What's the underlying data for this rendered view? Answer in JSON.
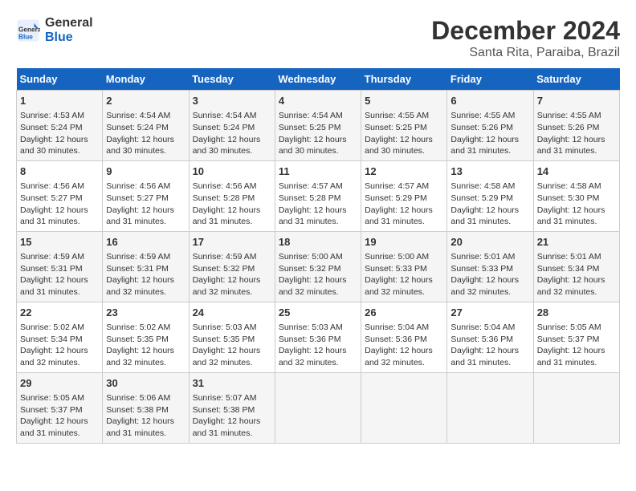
{
  "logo": {
    "line1": "General",
    "line2": "Blue"
  },
  "title": "December 2024",
  "subtitle": "Santa Rita, Paraiba, Brazil",
  "days_header": [
    "Sunday",
    "Monday",
    "Tuesday",
    "Wednesday",
    "Thursday",
    "Friday",
    "Saturday"
  ],
  "weeks": [
    [
      {
        "day": "1",
        "sunrise": "4:53 AM",
        "sunset": "5:24 PM",
        "daylight": "12 hours and 30 minutes."
      },
      {
        "day": "2",
        "sunrise": "4:54 AM",
        "sunset": "5:24 PM",
        "daylight": "12 hours and 30 minutes."
      },
      {
        "day": "3",
        "sunrise": "4:54 AM",
        "sunset": "5:24 PM",
        "daylight": "12 hours and 30 minutes."
      },
      {
        "day": "4",
        "sunrise": "4:54 AM",
        "sunset": "5:25 PM",
        "daylight": "12 hours and 30 minutes."
      },
      {
        "day": "5",
        "sunrise": "4:55 AM",
        "sunset": "5:25 PM",
        "daylight": "12 hours and 30 minutes."
      },
      {
        "day": "6",
        "sunrise": "4:55 AM",
        "sunset": "5:26 PM",
        "daylight": "12 hours and 31 minutes."
      },
      {
        "day": "7",
        "sunrise": "4:55 AM",
        "sunset": "5:26 PM",
        "daylight": "12 hours and 31 minutes."
      }
    ],
    [
      {
        "day": "8",
        "sunrise": "4:56 AM",
        "sunset": "5:27 PM",
        "daylight": "12 hours and 31 minutes."
      },
      {
        "day": "9",
        "sunrise": "4:56 AM",
        "sunset": "5:27 PM",
        "daylight": "12 hours and 31 minutes."
      },
      {
        "day": "10",
        "sunrise": "4:56 AM",
        "sunset": "5:28 PM",
        "daylight": "12 hours and 31 minutes."
      },
      {
        "day": "11",
        "sunrise": "4:57 AM",
        "sunset": "5:28 PM",
        "daylight": "12 hours and 31 minutes."
      },
      {
        "day": "12",
        "sunrise": "4:57 AM",
        "sunset": "5:29 PM",
        "daylight": "12 hours and 31 minutes."
      },
      {
        "day": "13",
        "sunrise": "4:58 AM",
        "sunset": "5:29 PM",
        "daylight": "12 hours and 31 minutes."
      },
      {
        "day": "14",
        "sunrise": "4:58 AM",
        "sunset": "5:30 PM",
        "daylight": "12 hours and 31 minutes."
      }
    ],
    [
      {
        "day": "15",
        "sunrise": "4:59 AM",
        "sunset": "5:31 PM",
        "daylight": "12 hours and 31 minutes."
      },
      {
        "day": "16",
        "sunrise": "4:59 AM",
        "sunset": "5:31 PM",
        "daylight": "12 hours and 32 minutes."
      },
      {
        "day": "17",
        "sunrise": "4:59 AM",
        "sunset": "5:32 PM",
        "daylight": "12 hours and 32 minutes."
      },
      {
        "day": "18",
        "sunrise": "5:00 AM",
        "sunset": "5:32 PM",
        "daylight": "12 hours and 32 minutes."
      },
      {
        "day": "19",
        "sunrise": "5:00 AM",
        "sunset": "5:33 PM",
        "daylight": "12 hours and 32 minutes."
      },
      {
        "day": "20",
        "sunrise": "5:01 AM",
        "sunset": "5:33 PM",
        "daylight": "12 hours and 32 minutes."
      },
      {
        "day": "21",
        "sunrise": "5:01 AM",
        "sunset": "5:34 PM",
        "daylight": "12 hours and 32 minutes."
      }
    ],
    [
      {
        "day": "22",
        "sunrise": "5:02 AM",
        "sunset": "5:34 PM",
        "daylight": "12 hours and 32 minutes."
      },
      {
        "day": "23",
        "sunrise": "5:02 AM",
        "sunset": "5:35 PM",
        "daylight": "12 hours and 32 minutes."
      },
      {
        "day": "24",
        "sunrise": "5:03 AM",
        "sunset": "5:35 PM",
        "daylight": "12 hours and 32 minutes."
      },
      {
        "day": "25",
        "sunrise": "5:03 AM",
        "sunset": "5:36 PM",
        "daylight": "12 hours and 32 minutes."
      },
      {
        "day": "26",
        "sunrise": "5:04 AM",
        "sunset": "5:36 PM",
        "daylight": "12 hours and 32 minutes."
      },
      {
        "day": "27",
        "sunrise": "5:04 AM",
        "sunset": "5:36 PM",
        "daylight": "12 hours and 31 minutes."
      },
      {
        "day": "28",
        "sunrise": "5:05 AM",
        "sunset": "5:37 PM",
        "daylight": "12 hours and 31 minutes."
      }
    ],
    [
      {
        "day": "29",
        "sunrise": "5:05 AM",
        "sunset": "5:37 PM",
        "daylight": "12 hours and 31 minutes."
      },
      {
        "day": "30",
        "sunrise": "5:06 AM",
        "sunset": "5:38 PM",
        "daylight": "12 hours and 31 minutes."
      },
      {
        "day": "31",
        "sunrise": "5:07 AM",
        "sunset": "5:38 PM",
        "daylight": "12 hours and 31 minutes."
      },
      null,
      null,
      null,
      null
    ]
  ],
  "labels": {
    "sunrise": "Sunrise:",
    "sunset": "Sunset:",
    "daylight": "Daylight:"
  }
}
